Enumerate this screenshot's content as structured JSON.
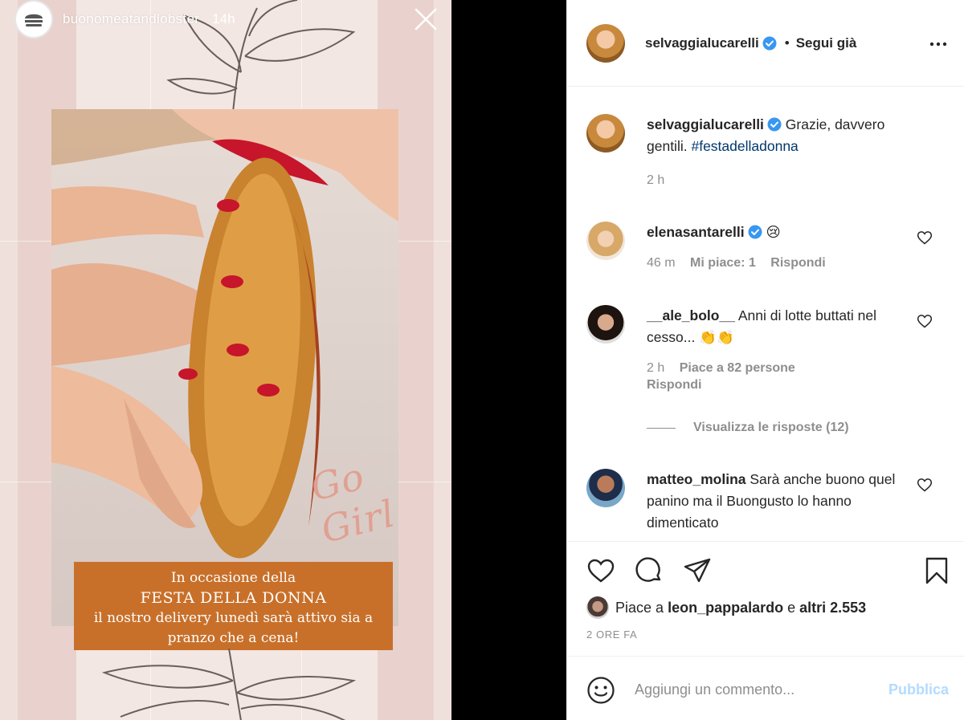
{
  "story": {
    "username": "buonomeatandlobster",
    "time": "14h",
    "overlay_text": "Go Girl",
    "promo": {
      "line1": "In occasione della",
      "line2": "FESTA DELLA DONNA",
      "line3": "il nostro delivery lunedì sarà attivo sia a",
      "line4": "pranzo che a cena!"
    }
  },
  "post": {
    "author": "selvaggialucarelli",
    "separator": "•",
    "follow_label": "Segui già",
    "caption": {
      "username": "selvaggialucarelli",
      "text": "Grazie, davvero gentili.",
      "hashtag": "#festadelladonna",
      "time": "2 h"
    },
    "comments": [
      {
        "username": "elenasantarelli",
        "verified": true,
        "text": "😢",
        "time": "46 m",
        "likes": "Mi piace: 1",
        "reply": "Rispondi"
      },
      {
        "username": "__ale_bolo__",
        "verified": false,
        "text": "Anni di lotte buttati nel cesso... 👏👏",
        "time": "2 h",
        "likes": "Piace a 82 persone",
        "reply": "Rispondi"
      },
      {
        "username": "matteo_molina",
        "verified": false,
        "text": "Sarà anche buono quel panino ma il Buongusto lo hanno dimenticato"
      }
    ],
    "view_replies": "Visualizza le risposte (12)",
    "likes_prefix": "Piace a",
    "likes_user": "leon_pappalardo",
    "likes_mid": "e",
    "likes_count": "altri 2.553",
    "posted_ago": "2 ORE FA",
    "comment_placeholder": "Aggiungi un commento...",
    "publish_label": "Pubblica"
  },
  "colors": {
    "verified": "#3897f0",
    "hashtag": "#00376b",
    "publish": "#b3dbff",
    "promo": "#c8702a"
  },
  "icons": [
    "close-icon",
    "more-icon",
    "verified-icon",
    "heart-icon",
    "comment-icon",
    "share-icon",
    "bookmark-icon",
    "emoji-icon"
  ]
}
